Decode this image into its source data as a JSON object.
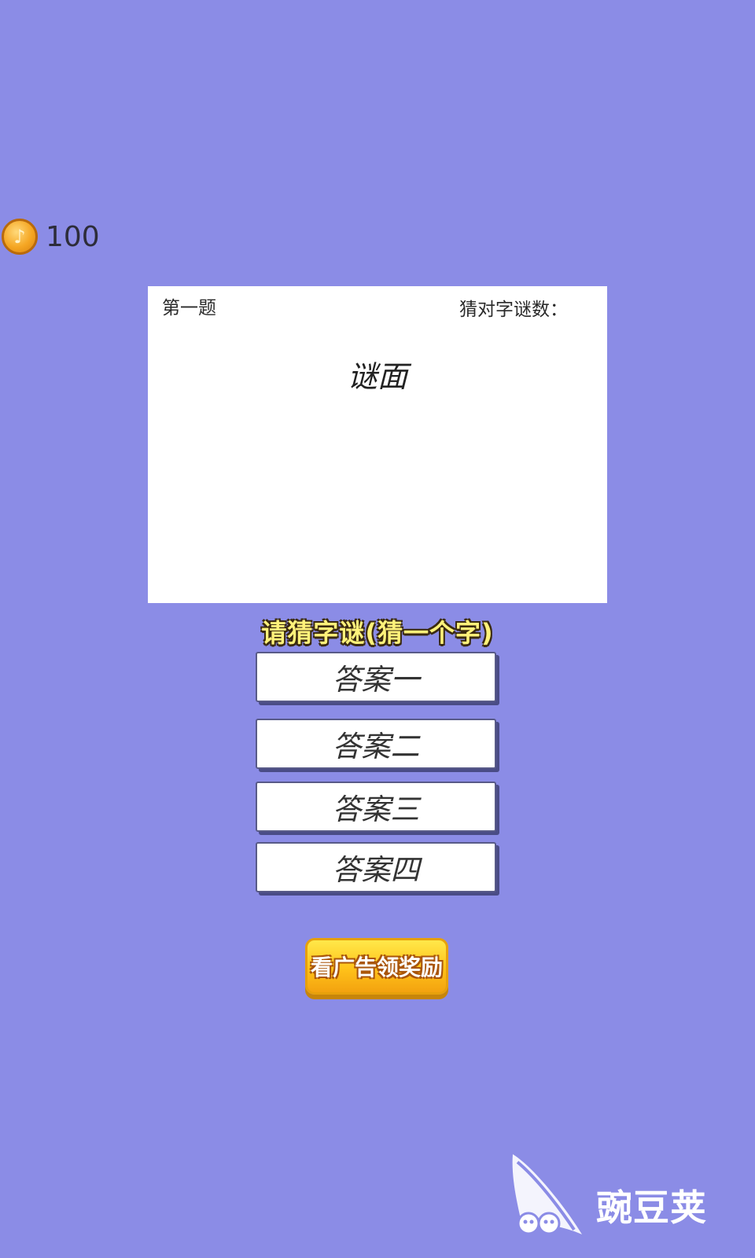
{
  "coins": {
    "icon": "music-note-coin-icon",
    "value": "100"
  },
  "riddle": {
    "number_label": "第一题",
    "solved_label": "猜对字谜数：",
    "face": "谜面"
  },
  "prompt": "请猜字谜(猜一个字)",
  "answers": [
    {
      "label": "答案一"
    },
    {
      "label": "答案二"
    },
    {
      "label": "答案三"
    },
    {
      "label": "答案四"
    }
  ],
  "ad_button": {
    "label": "看广告领奖励"
  },
  "watermark": {
    "text": "豌豆荚"
  },
  "colors": {
    "background": "#8b8ce6",
    "card": "#ffffff",
    "prompt": "#fff27a",
    "ad_button": "#ffc21a"
  }
}
